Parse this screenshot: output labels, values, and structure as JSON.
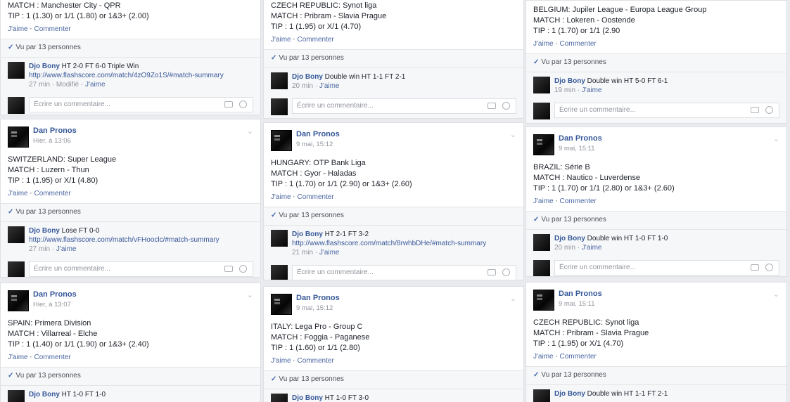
{
  "actions": {
    "like": "J'aime",
    "comment": "Commenter",
    "sep": "·"
  },
  "seen": "Vu par 13 personnes",
  "write_placeholder": "Écrire un commentaire...",
  "col1": {
    "p0": {
      "lines": [
        "MATCH : Manchester City - QPR",
        "TIP : 1 (1.30) or 1/1 (1.80) or 1&3+ (2.00)"
      ],
      "comment": {
        "name": "Djo Bony",
        "text": "HT 2-0 FT 6-0 Triple Win",
        "link": "http://www.flashscore.com/match/4zO9Zo1S/#match-summary",
        "time": "27 min",
        "extra": "Modifié",
        "like": "J'aime"
      }
    },
    "p1": {
      "name": "Dan Pronos",
      "date": "Hier, à 13:06",
      "lines": [
        "SWITZERLAND: Super League",
        "MATCH : Luzern - Thun",
        "TIP : 1 (1.95) or X/1 (4.80)"
      ],
      "comment": {
        "name": "Djo Bony",
        "text": "Lose FT 0-0",
        "link": "http://www.flashscore.com/match/vFHooclc/#match-summary",
        "time": "27 min",
        "like": "J'aime"
      }
    },
    "p2": {
      "name": "Dan Pronos",
      "date": "Hier, à 13:07",
      "lines": [
        "SPAIN: Primera Division",
        "MATCH : Villarreal - Elche",
        "TIP : 1 (1.40) or 1/1 (1.90) or 1&3+ (2.40)"
      ],
      "comment": {
        "name": "Djo Bony",
        "text": "HT 1-0 FT 1-0"
      }
    }
  },
  "col2": {
    "p0": {
      "lines": [
        "CZECH REPUBLIC: Synot liga",
        "MATCH : Pribram - Slavia Prague",
        "TIP : 1 (1.95) or X/1 (4.70)"
      ],
      "comment": {
        "name": "Djo Bony",
        "text": "Double win HT 1-1 FT 2-1",
        "time": "20 min",
        "like": "J'aime"
      }
    },
    "p1": {
      "name": "Dan Pronos",
      "date": "9 mai, 15:12",
      "lines": [
        "HUNGARY: OTP Bank Liga",
        "MATCH : Gyor - Haladas",
        "TIP : 1 (1.70) or 1/1 (2.90) or 1&3+ (2.60)"
      ],
      "comment": {
        "name": "Djo Bony",
        "text": "HT 2-1 FT 3-2",
        "link": "http://www.flashscore.com/match/8rwhbDHe/#match-summary",
        "time": "21 min",
        "like": "J'aime"
      }
    },
    "p2": {
      "name": "Dan Pronos",
      "date": "9 mai, 15:12",
      "lines": [
        "ITALY: Lega Pro - Group C",
        "MATCH : Foggia - Paganese",
        "TIP : 1 (1.60) or 1/1 (2.80)"
      ],
      "comment": {
        "name": "Djo Bony",
        "text": "HT 1-0 FT 3-0"
      }
    }
  },
  "col3": {
    "p0": {
      "lines": [
        "BELGIUM: Jupiler League - Europa League Group",
        "MATCH : Lokeren - Oostende",
        "TIP : 1 (1.70) or 1/1 (2.90"
      ],
      "comment": {
        "name": "Djo Bony",
        "text": "Double win HT 5-0 FT 6-1",
        "time": "19 min",
        "like": "J'aime"
      }
    },
    "p1": {
      "name": "Dan Pronos",
      "date": "9 mai, 15:11",
      "lines": [
        "BRAZIL: Série B",
        "MATCH : Nautico - Luverdense",
        "TIP : 1 (1.70) or 1/1 (2.80) or 1&3+ (2.60)"
      ],
      "comment": {
        "name": "Djo Bony",
        "text": "Double win HT 1-0 FT 1-0",
        "time": "20 min",
        "like": "J'aime"
      }
    },
    "p2": {
      "name": "Dan Pronos",
      "date": "9 mai, 15:11",
      "lines": [
        "CZECH REPUBLIC: Synot liga",
        "MATCH : Pribram - Slavia Prague",
        "TIP : 1 (1.95) or X/1 (4.70)"
      ],
      "comment": {
        "name": "Djo Bony",
        "text": "Double win HT 1-1 FT 2-1"
      }
    }
  }
}
